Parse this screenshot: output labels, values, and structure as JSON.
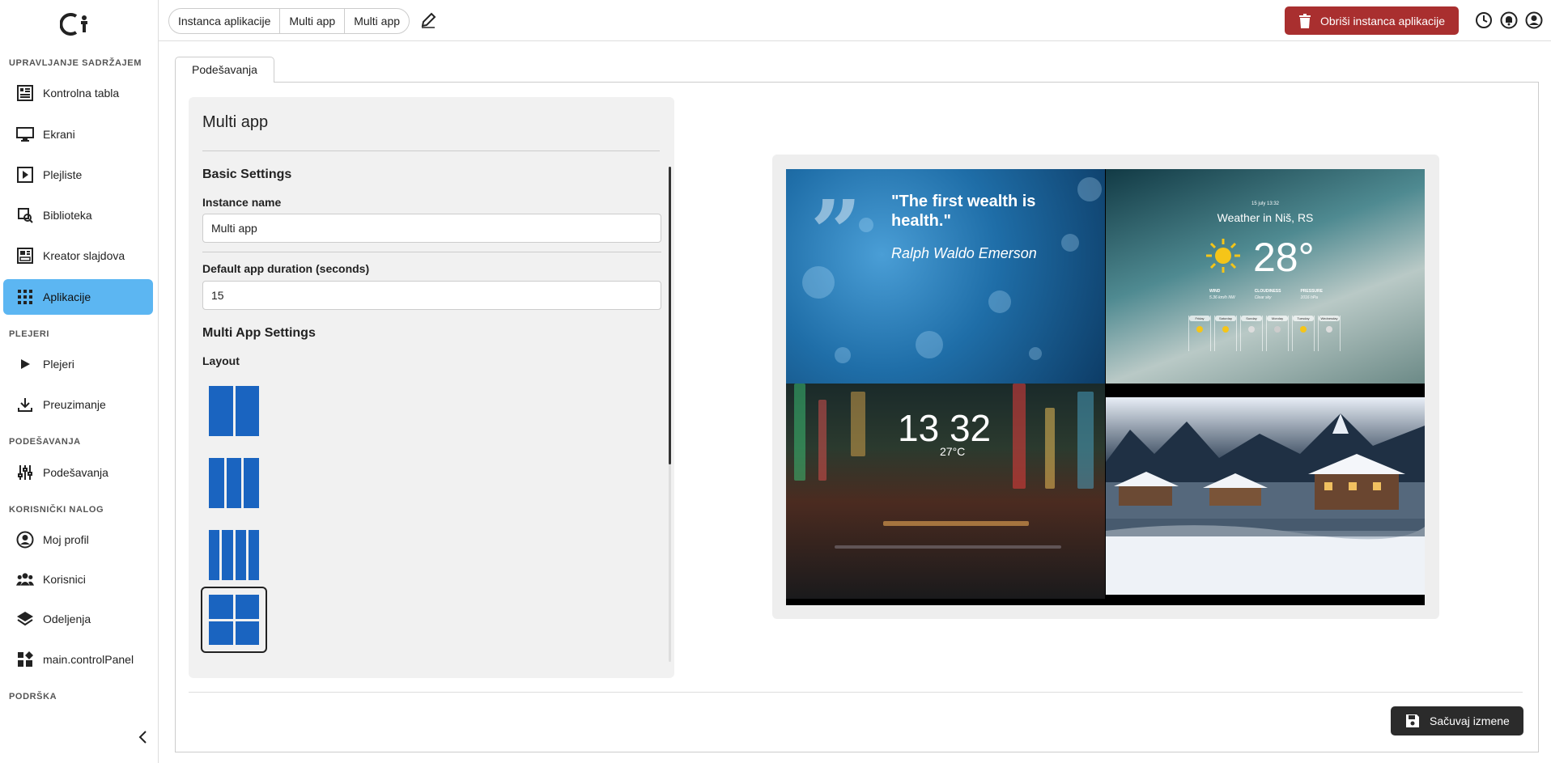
{
  "sidebar": {
    "sections": {
      "content": "UPRAVLJANJE SADRŽAJEM",
      "players": "PLEJERI",
      "settings": "PODEŠAVANJA",
      "account": "KORISNIČKI NALOG",
      "support": "PODRŠKA"
    },
    "items": {
      "dashboard": "Kontrolna tabla",
      "screens": "Ekrani",
      "playlists": "Plejliste",
      "library": "Biblioteka",
      "slide_creator": "Kreator slajdova",
      "apps": "Aplikacije",
      "players": "Plejeri",
      "download": "Preuzimanje",
      "settings": "Podešavanja",
      "profile": "Moj profil",
      "users": "Korisnici",
      "departments": "Odeljenja",
      "control_panel": "main.controlPanel"
    },
    "active": "apps"
  },
  "breadcrumb": [
    "Instanca aplikacije",
    "Multi app",
    "Multi app"
  ],
  "toolbar": {
    "delete_label": "Obriši instanca aplikacije"
  },
  "tabs": [
    "Podešavanja"
  ],
  "settings": {
    "title": "Multi app",
    "basic_heading": "Basic Settings",
    "instance_name_label": "Instance name",
    "instance_name_value": "Multi app",
    "duration_label": "Default app duration (seconds)",
    "duration_value": "15",
    "multi_heading": "Multi App Settings",
    "layout_label": "Layout",
    "layouts": [
      "2-columns",
      "3-columns",
      "4-columns",
      "2x2-grid"
    ],
    "selected_layout": "2x2-grid"
  },
  "preview": {
    "quote_text": "\"The first wealth is health.\"",
    "quote_author": "Ralph Waldo Emerson",
    "weather_date": "15 july 13:32",
    "weather_title": "Weather in Niš, RS",
    "weather_temp": "28°",
    "weather_stats": [
      {
        "label": "WIND",
        "value": "5.36 km/h NW"
      },
      {
        "label": "CLOUDINESS",
        "value": "Clear sky"
      },
      {
        "label": "PRESSURE",
        "value": "1016 hPa"
      }
    ],
    "forecast_days": [
      "Friday",
      "Saturday",
      "Sunday",
      "Monday",
      "Tuesday",
      "Wednesday"
    ],
    "clock_time": "13 32",
    "clock_temp": "27°C"
  },
  "footer": {
    "save_label": "Sačuvaj izmene"
  },
  "colors": {
    "accent": "#5cb6f2",
    "danger": "#a92f2f",
    "layout_blue": "#1a64c0",
    "dark_button": "#2b2b2b"
  }
}
